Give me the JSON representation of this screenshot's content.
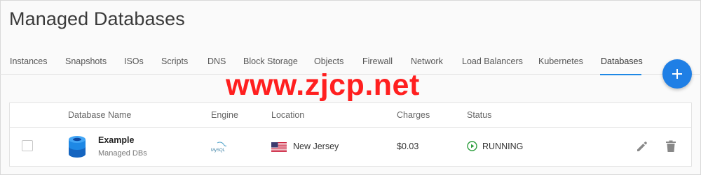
{
  "page": {
    "title": "Managed Databases"
  },
  "tabs": [
    {
      "label": "Instances",
      "active": false
    },
    {
      "label": "Snapshots",
      "active": false
    },
    {
      "label": "ISOs",
      "active": false
    },
    {
      "label": "Scripts",
      "active": false
    },
    {
      "label": "DNS",
      "active": false
    },
    {
      "label": "Block Storage",
      "active": false
    },
    {
      "label": "Objects",
      "active": false
    },
    {
      "label": "Firewall",
      "active": false
    },
    {
      "label": "Network",
      "active": false
    },
    {
      "label": "Load Balancers",
      "active": false
    },
    {
      "label": "Kubernetes",
      "active": false
    },
    {
      "label": "Databases",
      "active": true
    }
  ],
  "fab": {
    "icon": "plus-icon",
    "color": "#1f7fe5"
  },
  "watermark": {
    "text": "www.zjcp.net",
    "color": "#ff1f1f"
  },
  "table": {
    "columns": {
      "name": "Database Name",
      "engine": "Engine",
      "location": "Location",
      "charges": "Charges",
      "status": "Status"
    },
    "rows": [
      {
        "name": "Example",
        "subtitle": "Managed DBs",
        "engine_icon": "mysql-logo",
        "engine_logo_text": "MySQL",
        "location_flag": "us-flag",
        "location": "New Jersey",
        "charges": "$0.03",
        "status": "RUNNING",
        "status_color": "#2e9e3e"
      }
    ]
  },
  "colors": {
    "accent": "#1e88e5",
    "running": "#2e9e3e"
  }
}
